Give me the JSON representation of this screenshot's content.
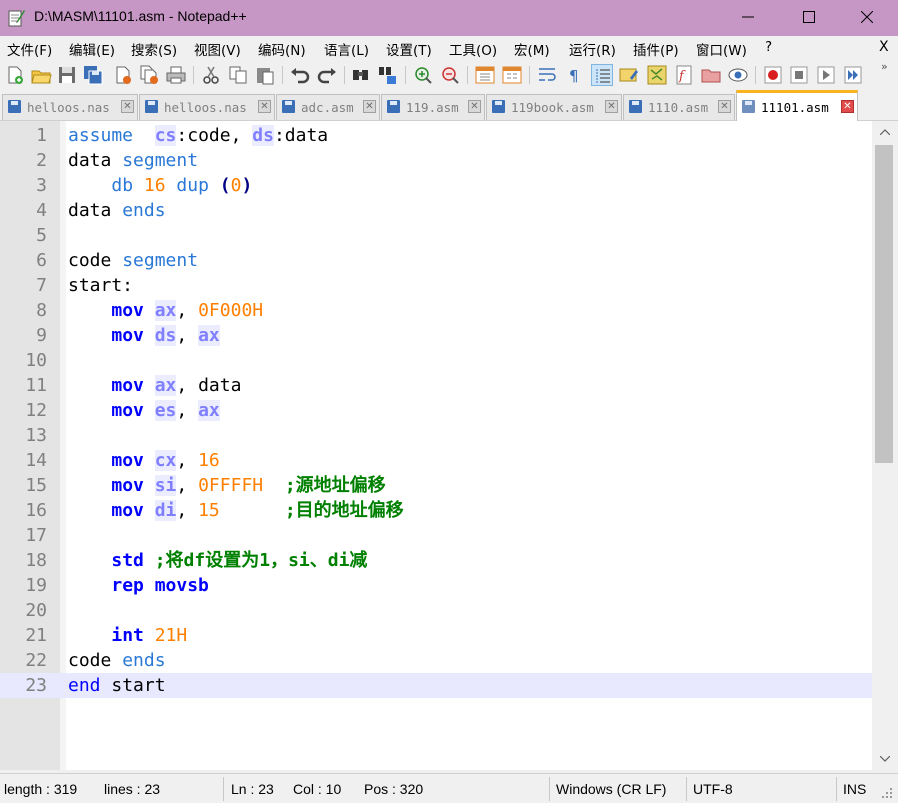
{
  "window": {
    "title": "D:\\MASM\\11101.asm - Notepad++",
    "app_icon": "notepad-plus-plus-icon",
    "controls": [
      "minimize-icon",
      "maximize-icon",
      "close-icon"
    ]
  },
  "menu": {
    "items": [
      "文件(F)",
      "编辑(E)",
      "搜索(S)",
      "视图(V)",
      "编码(N)",
      "语言(L)",
      "设置(T)",
      "工具(O)",
      "宏(M)",
      "运行(R)",
      "插件(P)",
      "窗口(W)",
      "?"
    ],
    "close_label": "X"
  },
  "toolbar": {
    "icons": [
      "new-file-icon",
      "open-file-icon",
      "save-icon",
      "save-all-icon",
      "close-icon",
      "close-all-icon",
      "print-icon",
      "cut-icon",
      "copy-icon",
      "paste-icon",
      "undo-icon",
      "redo-icon",
      "find-icon",
      "replace-icon",
      "zoom-in-icon",
      "zoom-out-icon",
      "sync-vertical-icon",
      "sync-horizontal-icon",
      "word-wrap-icon",
      "show-all-characters-icon",
      "indent-guide-icon",
      "user-language-icon",
      "doc-map-icon",
      "function-list-icon",
      "folder-as-workspace-icon",
      "monitoring-icon",
      "record-macro-icon",
      "stop-macro-icon",
      "play-macro-icon",
      "run-macro-multiple-icon"
    ],
    "more_label": "»"
  },
  "tabs": [
    {
      "label": "helloos.nas",
      "active": false
    },
    {
      "label": "helloos.nas",
      "active": false
    },
    {
      "label": "adc.asm",
      "active": false
    },
    {
      "label": "119.asm",
      "active": false
    },
    {
      "label": "119book.asm",
      "active": false
    },
    {
      "label": "1110.asm",
      "active": false
    },
    {
      "label": "11101.asm",
      "active": true
    }
  ],
  "editor": {
    "current_line": 23,
    "lines": [
      {
        "n": "1",
        "tokens": [
          [
            "kw-blue",
            "assume"
          ],
          [
            "",
            "  "
          ],
          [
            "reg",
            "cs"
          ],
          [
            "",
            ":code, "
          ],
          [
            "reg",
            "ds"
          ],
          [
            "",
            ":data"
          ]
        ]
      },
      {
        "n": "2",
        "tokens": [
          [
            "",
            "data "
          ],
          [
            "kw-blue",
            "segment"
          ]
        ]
      },
      {
        "n": "3",
        "tokens": [
          [
            "",
            "    "
          ],
          [
            "kw-blue",
            "db"
          ],
          [
            "",
            " "
          ],
          [
            "num",
            "16"
          ],
          [
            "",
            " "
          ],
          [
            "kw-blue",
            "dup"
          ],
          [
            "",
            " "
          ],
          [
            "paren",
            "("
          ],
          [
            "num",
            "0"
          ],
          [
            "paren",
            ")"
          ]
        ]
      },
      {
        "n": "4",
        "tokens": [
          [
            "",
            "data "
          ],
          [
            "kw-blue",
            "ends"
          ]
        ]
      },
      {
        "n": "5",
        "tokens": []
      },
      {
        "n": "6",
        "tokens": [
          [
            "",
            "code "
          ],
          [
            "kw-blue",
            "segment"
          ]
        ]
      },
      {
        "n": "7",
        "tokens": [
          [
            "",
            "start:"
          ]
        ]
      },
      {
        "n": "8",
        "tokens": [
          [
            "",
            "    "
          ],
          [
            "ins",
            "mov"
          ],
          [
            "",
            " "
          ],
          [
            "reg",
            "ax"
          ],
          [
            "",
            ", "
          ],
          [
            "num",
            "0F000H"
          ]
        ]
      },
      {
        "n": "9",
        "tokens": [
          [
            "",
            "    "
          ],
          [
            "ins",
            "mov"
          ],
          [
            "",
            " "
          ],
          [
            "reg",
            "ds"
          ],
          [
            "",
            ", "
          ],
          [
            "reg",
            "ax"
          ]
        ]
      },
      {
        "n": "10",
        "tokens": []
      },
      {
        "n": "11",
        "tokens": [
          [
            "",
            "    "
          ],
          [
            "ins",
            "mov"
          ],
          [
            "",
            " "
          ],
          [
            "reg",
            "ax"
          ],
          [
            "",
            ", data"
          ]
        ]
      },
      {
        "n": "12",
        "tokens": [
          [
            "",
            "    "
          ],
          [
            "ins",
            "mov"
          ],
          [
            "",
            " "
          ],
          [
            "reg",
            "es"
          ],
          [
            "",
            ", "
          ],
          [
            "reg",
            "ax"
          ]
        ]
      },
      {
        "n": "13",
        "tokens": []
      },
      {
        "n": "14",
        "tokens": [
          [
            "",
            "    "
          ],
          [
            "ins",
            "mov"
          ],
          [
            "",
            " "
          ],
          [
            "reg",
            "cx"
          ],
          [
            "",
            ", "
          ],
          [
            "num",
            "16"
          ]
        ]
      },
      {
        "n": "15",
        "tokens": [
          [
            "",
            "    "
          ],
          [
            "ins",
            "mov"
          ],
          [
            "",
            " "
          ],
          [
            "reg",
            "si"
          ],
          [
            "",
            ", "
          ],
          [
            "num",
            "0FFFFH"
          ],
          [
            "",
            "  "
          ],
          [
            "cmt",
            ";源地址偏移"
          ]
        ]
      },
      {
        "n": "16",
        "tokens": [
          [
            "",
            "    "
          ],
          [
            "ins",
            "mov"
          ],
          [
            "",
            " "
          ],
          [
            "reg",
            "di"
          ],
          [
            "",
            ", "
          ],
          [
            "num",
            "15"
          ],
          [
            "",
            "      "
          ],
          [
            "cmt",
            ";目的地址偏移"
          ]
        ]
      },
      {
        "n": "17",
        "tokens": []
      },
      {
        "n": "18",
        "tokens": [
          [
            "",
            "    "
          ],
          [
            "ins",
            "std"
          ],
          [
            "",
            " "
          ],
          [
            "cmt",
            ";将df设置为1，si、di减"
          ]
        ]
      },
      {
        "n": "19",
        "tokens": [
          [
            "",
            "    "
          ],
          [
            "ins",
            "rep movsb"
          ]
        ]
      },
      {
        "n": "20",
        "tokens": []
      },
      {
        "n": "21",
        "tokens": [
          [
            "",
            "    "
          ],
          [
            "ins",
            "int"
          ],
          [
            "",
            " "
          ],
          [
            "num",
            "21H"
          ]
        ]
      },
      {
        "n": "22",
        "tokens": [
          [
            "",
            "code "
          ],
          [
            "kw-blue",
            "ends"
          ]
        ]
      },
      {
        "n": "23",
        "tokens": [
          [
            "kw-dir",
            "end"
          ],
          [
            "",
            " start"
          ]
        ]
      }
    ]
  },
  "status": {
    "length": "length : 319",
    "lines": "lines : 23",
    "ln": "Ln : 23",
    "col": "Col : 10",
    "pos": "Pos : 320",
    "eol": "Windows (CR LF)",
    "encoding": "UTF-8",
    "mode": "INS"
  }
}
